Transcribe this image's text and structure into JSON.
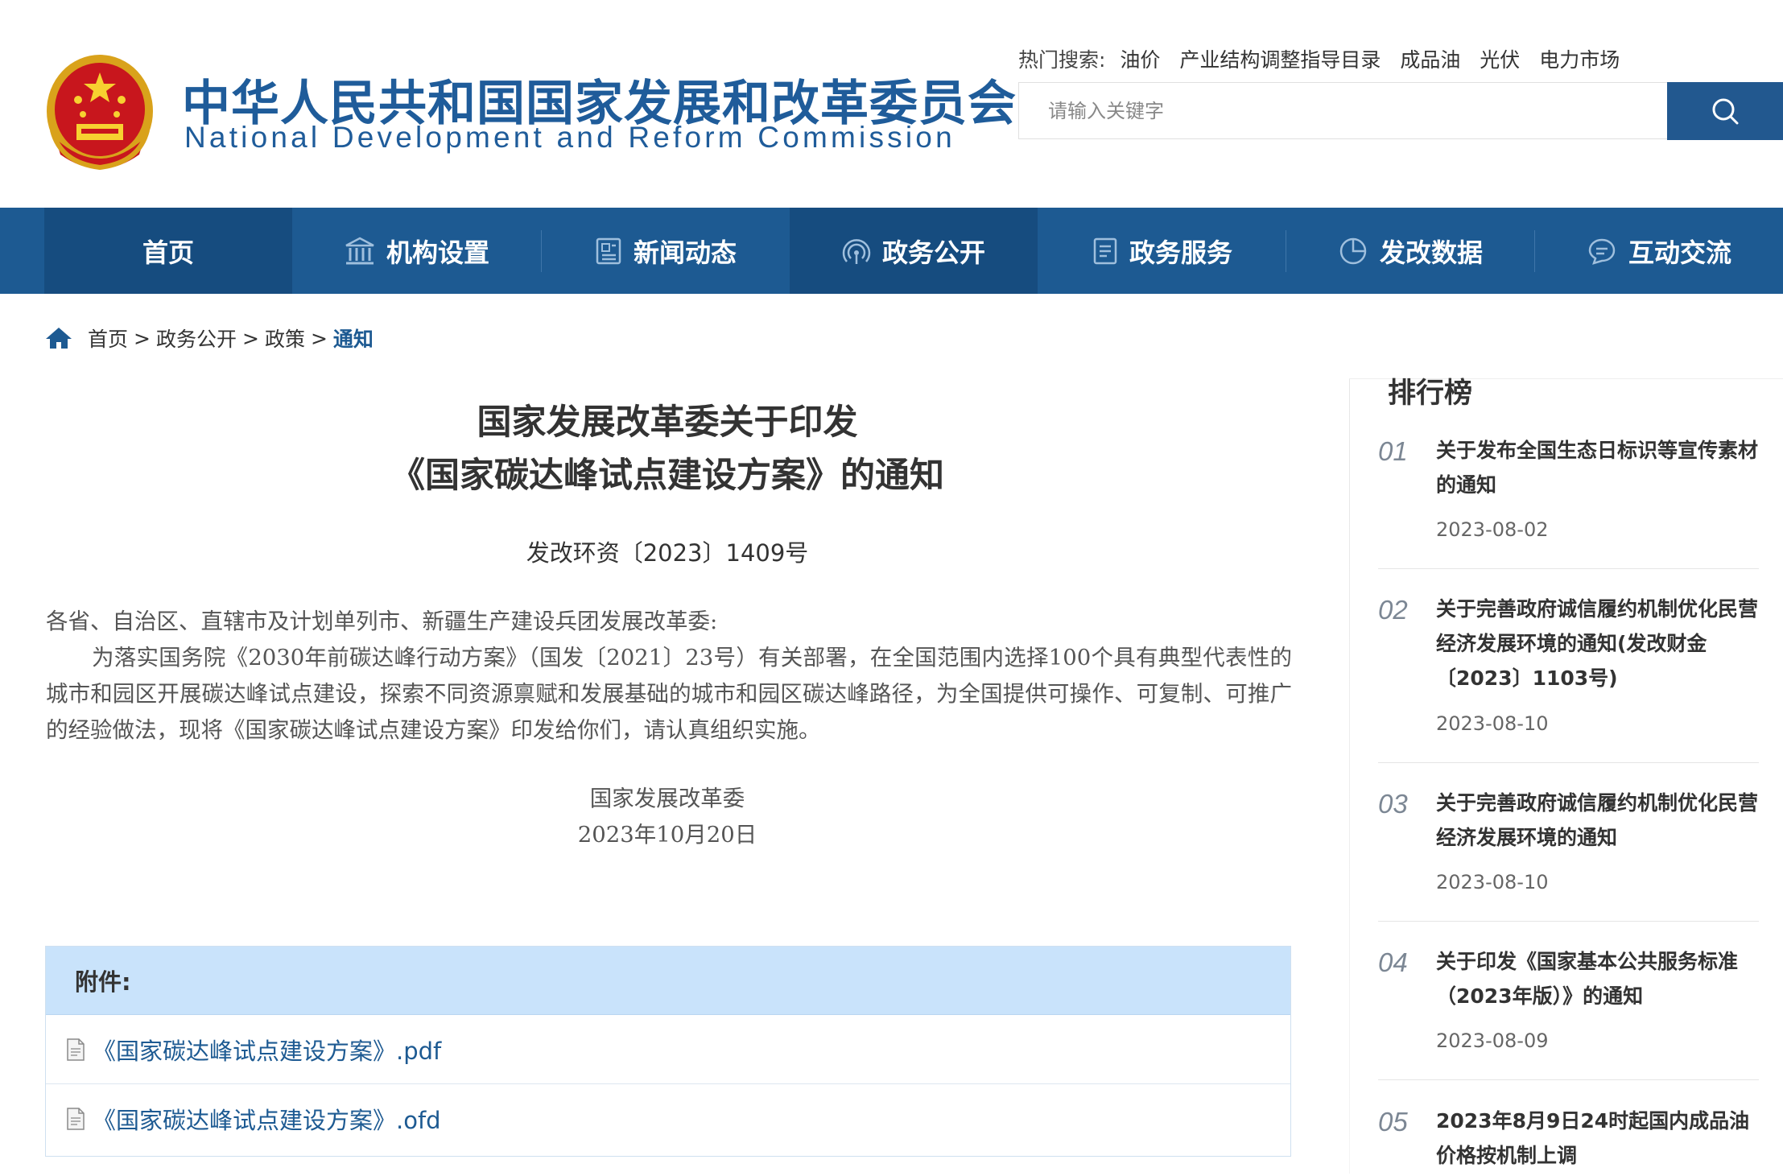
{
  "header": {
    "site_name_cn": "中华人民共和国国家发展和改革委员会",
    "site_name_en": "National Development and Reform Commission",
    "hot_label": "热门搜索:",
    "hot_keywords": [
      "油价",
      "产业结构调整指导目录",
      "成品油",
      "光伏",
      "电力市场"
    ],
    "search_placeholder": "请输入关键字"
  },
  "nav": {
    "items": [
      {
        "label": "首页",
        "icon": "home"
      },
      {
        "label": "机构设置",
        "icon": "building-icon"
      },
      {
        "label": "新闻动态",
        "icon": "news-icon"
      },
      {
        "label": "政务公开",
        "icon": "broadcast-icon"
      },
      {
        "label": "政务服务",
        "icon": "document-icon"
      },
      {
        "label": "发改数据",
        "icon": "pie-chart-icon"
      },
      {
        "label": "互动交流",
        "icon": "chat-icon"
      }
    ]
  },
  "breadcrumb": {
    "items": [
      "首页",
      "政务公开",
      "政策"
    ],
    "separator": ">",
    "current": "通知"
  },
  "article": {
    "title_line1": "国家发展改革委关于印发",
    "title_line2": "《国家碳达峰试点建设方案》的通知",
    "doc_number": "发改环资〔2023〕1409号",
    "salutation": "各省、自治区、直辖市及计划单列市、新疆生产建设兵团发展改革委:",
    "paragraph": "为落实国务院《2030年前碳达峰行动方案》（国发〔2021〕23号）有关部署，在全国范围内选择100个具有典型代表性的城市和园区开展碳达峰试点建设，探索不同资源禀赋和发展基础的城市和园区碳达峰路径，为全国提供可操作、可复制、可推广的经验做法，现将《国家碳达峰试点建设方案》印发给你们，请认真组织实施。",
    "signature": "国家发展改革委",
    "date": "2023年10月20日"
  },
  "attachments": {
    "header": "附件:",
    "files": [
      "《国家碳达峰试点建设方案》.pdf",
      "《国家碳达峰试点建设方案》.ofd"
    ]
  },
  "ranking": {
    "title": "排行榜",
    "items": [
      {
        "num": "01",
        "title": "关于发布全国生态日标识等宣传素材的通知",
        "date": "2023-08-02"
      },
      {
        "num": "02",
        "title": "关于完善政府诚信履约机制优化民营经济发展环境的通知(发改财金〔2023〕1103号)",
        "date": "2023-08-10"
      },
      {
        "num": "03",
        "title": "关于完善政府诚信履约机制优化民营经济发展环境的通知",
        "date": "2023-08-10"
      },
      {
        "num": "04",
        "title": "关于印发《国家基本公共服务标准（2023年版）》的通知",
        "date": "2023-08-09"
      },
      {
        "num": "05",
        "title": "2023年8月9日24时起国内成品油价格按机制上调",
        "date": ""
      }
    ]
  },
  "colors": {
    "brand_blue": "#1d5a92",
    "nav_active": "#164c7f",
    "attach_header_bg": "#c9e3fb"
  }
}
